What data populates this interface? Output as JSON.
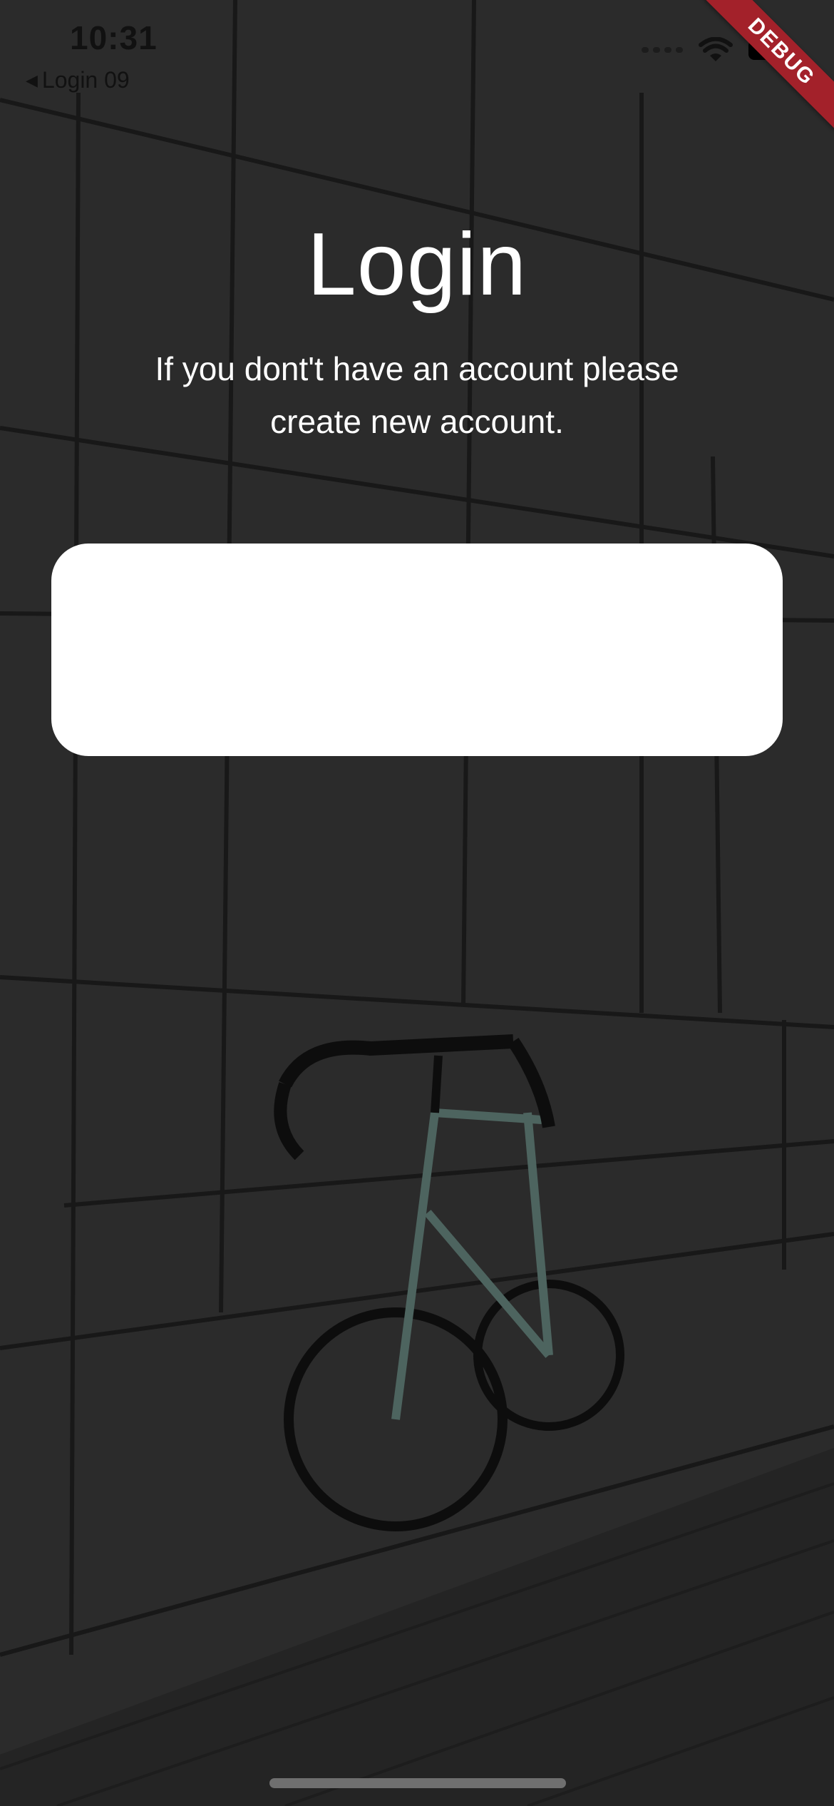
{
  "status_bar": {
    "time": "10:31",
    "back_label": "Login 09",
    "back_icon": "back-triangle-icon"
  },
  "debug_banner": "DEBUG",
  "login": {
    "title": "Login",
    "subtitle": "If you dont't have an account please create new account."
  },
  "colors": {
    "wall": "#333333",
    "pavement": "#2a2a2a",
    "debug_ribbon": "#a3212a",
    "text": "#ffffff",
    "card": "#ffffff"
  }
}
